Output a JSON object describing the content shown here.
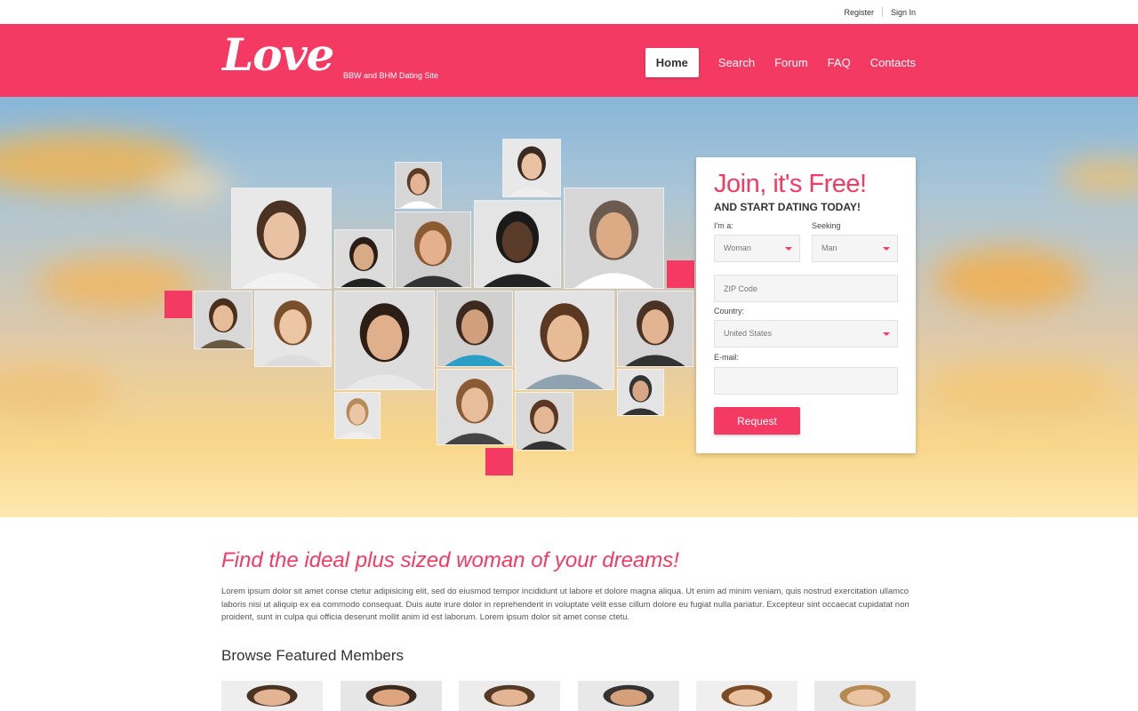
{
  "topbar": {
    "register": "Register",
    "sign_in": "Sign In"
  },
  "brand": {
    "logo": "Love",
    "tagline": "BBW and BHM Dating Site",
    "accent": "#f43a63"
  },
  "nav": {
    "items": [
      "Home",
      "Search",
      "Forum",
      "FAQ",
      "Contacts"
    ],
    "active": "Home"
  },
  "join": {
    "title": "Join, it's Free!",
    "subtitle": "AND START DATING TODAY!",
    "im_label": "I'm a:",
    "im_value": "Woman",
    "seeking_label": "Seeking",
    "seeking_value": "Man",
    "zip_placeholder": "ZIP Code",
    "country_label": "Country:",
    "country_value": "United States",
    "email_label": "E-mail:",
    "email_value": "",
    "button": "Request"
  },
  "main": {
    "headline": "Find the ideal plus sized woman of your dreams!",
    "body": "Lorem ipsum dolor sit amet conse ctetur adipisicing elit, sed do eiusmod tempor incididunt ut labore et dolore magna aliqua. Ut enim ad minim veniam, quis nostrud exercitation ullamco laboris nisi ut aliquip ex ea commodo consequat. Duis aute irure dolor in reprehenderit in voluptate velit esse cillum dolore eu fugiat nulla pariatur. Excepteur sint occaecat cupidatat non proident, sunt in culpa qui officia deserunt mollit anim id est laborum. Lorem ipsum dolor sit amet conse ctetu.",
    "browse_title": "Browse Featured Members"
  }
}
